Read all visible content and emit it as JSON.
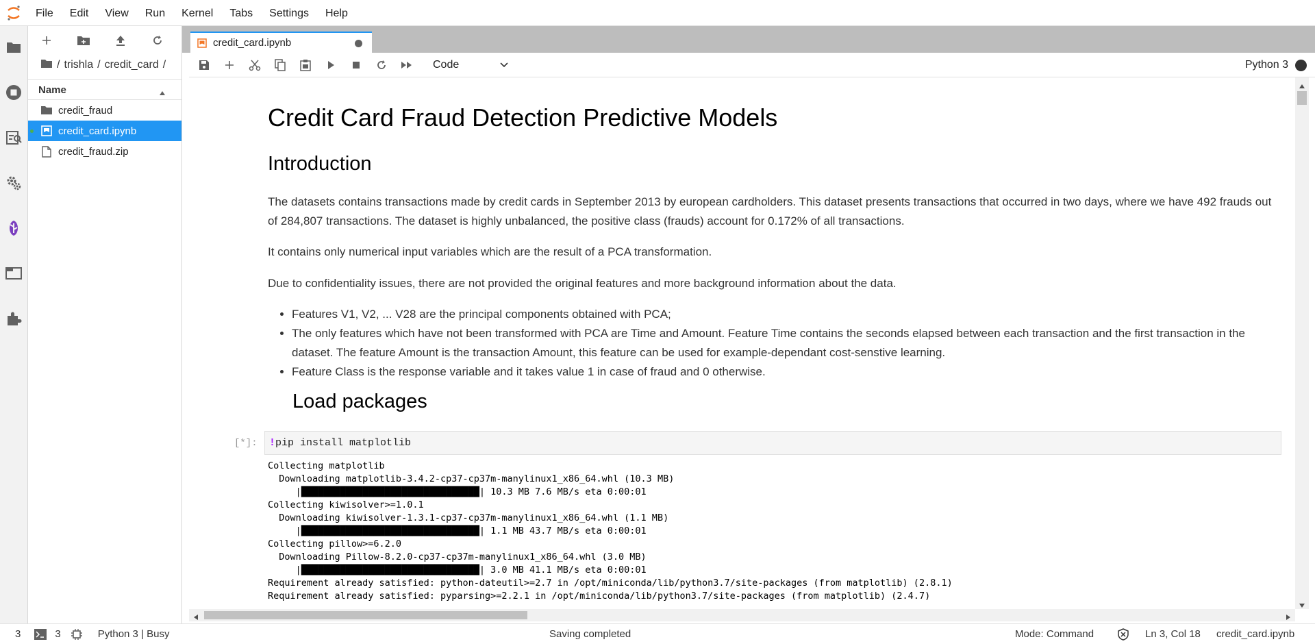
{
  "menubar": {
    "items": [
      "File",
      "Edit",
      "View",
      "Run",
      "Kernel",
      "Tabs",
      "Settings",
      "Help"
    ]
  },
  "leftbar": {
    "icons": [
      "folder-icon",
      "running-icon",
      "commands-icon",
      "property-inspector-icon",
      "git-icon",
      "tabs-icon",
      "extensions-icon"
    ]
  },
  "filebrowser": {
    "breadcrumb": [
      "/",
      "trishla",
      "/",
      "credit_card",
      "/"
    ],
    "header": "Name",
    "files": [
      {
        "name": "credit_fraud",
        "type": "folder",
        "selected": false
      },
      {
        "name": "credit_card.ipynb",
        "type": "notebook",
        "selected": true
      },
      {
        "name": "credit_fraud.zip",
        "type": "file",
        "selected": false
      }
    ]
  },
  "tab": {
    "title": "credit_card.ipynb"
  },
  "toolbar": {
    "cell_type": "Code",
    "kernel_name": "Python 3"
  },
  "notebook": {
    "title": "Credit Card Fraud Detection Predictive Models",
    "intro_heading": "Introduction",
    "p1": "The datasets contains transactions made by credit cards in September 2013 by european cardholders. This dataset presents transactions that occurred in two days, where we have 492 frauds out of 284,807 transactions. The dataset is highly unbalanced, the positive class (frauds) account for 0.172% of all transactions.",
    "p2": "It contains only numerical input variables which are the result of a PCA transformation.",
    "p3": "Due to confidentiality issues, there are not provided the original features and more background information about the data.",
    "bullets": [
      "Features V1, V2, ... V28 are the principal components obtained with PCA;",
      "The only features which have not been transformed with PCA are Time and Amount. Feature Time contains the seconds elapsed between each transaction and the first transaction in the dataset. The feature Amount is the transaction Amount, this feature can be used for example-dependant cost-senstive learning.",
      "Feature Class is the response variable and it takes value 1 in case of fraud and 0 otherwise."
    ],
    "load_heading": "Load packages",
    "cell_prompt": "[*]:",
    "cell_code_bang": "!",
    "cell_code_rest": "pip install matplotlib",
    "output_lines": [
      "Collecting matplotlib",
      "  Downloading matplotlib-3.4.2-cp37-cp37m-manylinux1_x86_64.whl (10.3 MB)",
      "     |████████████████████████████████| 10.3 MB 7.6 MB/s eta 0:00:01",
      "Collecting kiwisolver>=1.0.1",
      "  Downloading kiwisolver-1.3.1-cp37-cp37m-manylinux1_x86_64.whl (1.1 MB)",
      "     |████████████████████████████████| 1.1 MB 43.7 MB/s eta 0:00:01",
      "Collecting pillow>=6.2.0",
      "  Downloading Pillow-8.2.0-cp37-cp37m-manylinux1_x86_64.whl (3.0 MB)",
      "     |████████████████████████████████| 3.0 MB 41.1 MB/s eta 0:00:01",
      "Requirement already satisfied: python-dateutil>=2.7 in /opt/miniconda/lib/python3.7/site-packages (from matplotlib) (2.8.1)",
      "Requirement already satisfied: pyparsing>=2.2.1 in /opt/miniconda/lib/python3.7/site-packages (from matplotlib) (2.4.7)"
    ]
  },
  "statusbar": {
    "count1": "3",
    "count2": "3",
    "kernel_status": "Python 3 | Busy",
    "saving": "Saving completed",
    "mode": "Mode: Command",
    "position": "Ln 3, Col 18",
    "filename": "credit_card.ipynb"
  },
  "colors": {
    "accent": "#2196f3",
    "orange": "#f37726"
  }
}
